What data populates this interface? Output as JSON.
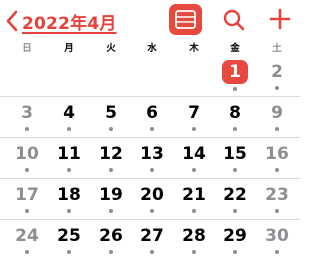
{
  "header": {
    "month_label": "2022年4月"
  },
  "weekdays": [
    "日",
    "月",
    "火",
    "水",
    "木",
    "金",
    "土"
  ],
  "weeks": [
    [
      {
        "day": "",
        "weekend": true,
        "dot": false,
        "today": false
      },
      {
        "day": "",
        "weekend": false,
        "dot": false,
        "today": false
      },
      {
        "day": "",
        "weekend": false,
        "dot": false,
        "today": false
      },
      {
        "day": "",
        "weekend": false,
        "dot": false,
        "today": false
      },
      {
        "day": "",
        "weekend": false,
        "dot": false,
        "today": false
      },
      {
        "day": "1",
        "weekend": false,
        "dot": true,
        "today": true
      },
      {
        "day": "2",
        "weekend": true,
        "dot": true,
        "today": false
      }
    ],
    [
      {
        "day": "3",
        "weekend": true,
        "dot": true,
        "today": false
      },
      {
        "day": "4",
        "weekend": false,
        "dot": true,
        "today": false
      },
      {
        "day": "5",
        "weekend": false,
        "dot": true,
        "today": false
      },
      {
        "day": "6",
        "weekend": false,
        "dot": true,
        "today": false
      },
      {
        "day": "7",
        "weekend": false,
        "dot": true,
        "today": false
      },
      {
        "day": "8",
        "weekend": false,
        "dot": true,
        "today": false
      },
      {
        "day": "9",
        "weekend": true,
        "dot": true,
        "today": false
      }
    ],
    [
      {
        "day": "10",
        "weekend": true,
        "dot": true,
        "today": false
      },
      {
        "day": "11",
        "weekend": false,
        "dot": true,
        "today": false
      },
      {
        "day": "12",
        "weekend": false,
        "dot": true,
        "today": false
      },
      {
        "day": "13",
        "weekend": false,
        "dot": true,
        "today": false
      },
      {
        "day": "14",
        "weekend": false,
        "dot": true,
        "today": false
      },
      {
        "day": "15",
        "weekend": false,
        "dot": true,
        "today": false
      },
      {
        "day": "16",
        "weekend": true,
        "dot": true,
        "today": false
      }
    ],
    [
      {
        "day": "17",
        "weekend": true,
        "dot": true,
        "today": false
      },
      {
        "day": "18",
        "weekend": false,
        "dot": true,
        "today": false
      },
      {
        "day": "19",
        "weekend": false,
        "dot": true,
        "today": false
      },
      {
        "day": "20",
        "weekend": false,
        "dot": true,
        "today": false
      },
      {
        "day": "21",
        "weekend": false,
        "dot": true,
        "today": false
      },
      {
        "day": "22",
        "weekend": false,
        "dot": true,
        "today": false
      },
      {
        "day": "23",
        "weekend": true,
        "dot": true,
        "today": false
      }
    ],
    [
      {
        "day": "24",
        "weekend": true,
        "dot": true,
        "today": false
      },
      {
        "day": "25",
        "weekend": false,
        "dot": true,
        "today": false
      },
      {
        "day": "26",
        "weekend": false,
        "dot": true,
        "today": false
      },
      {
        "day": "27",
        "weekend": false,
        "dot": true,
        "today": false
      },
      {
        "day": "28",
        "weekend": false,
        "dot": true,
        "today": false
      },
      {
        "day": "29",
        "weekend": false,
        "dot": true,
        "today": false
      },
      {
        "day": "30",
        "weekend": true,
        "dot": true,
        "today": false
      }
    ]
  ],
  "icons": {
    "back": "chevron-left-icon",
    "list": "list-view-icon",
    "search": "search-icon",
    "add": "plus-icon"
  },
  "colors": {
    "accent": "#e8493f",
    "weekend": "#8e8e93",
    "divider": "#d9d9de"
  }
}
